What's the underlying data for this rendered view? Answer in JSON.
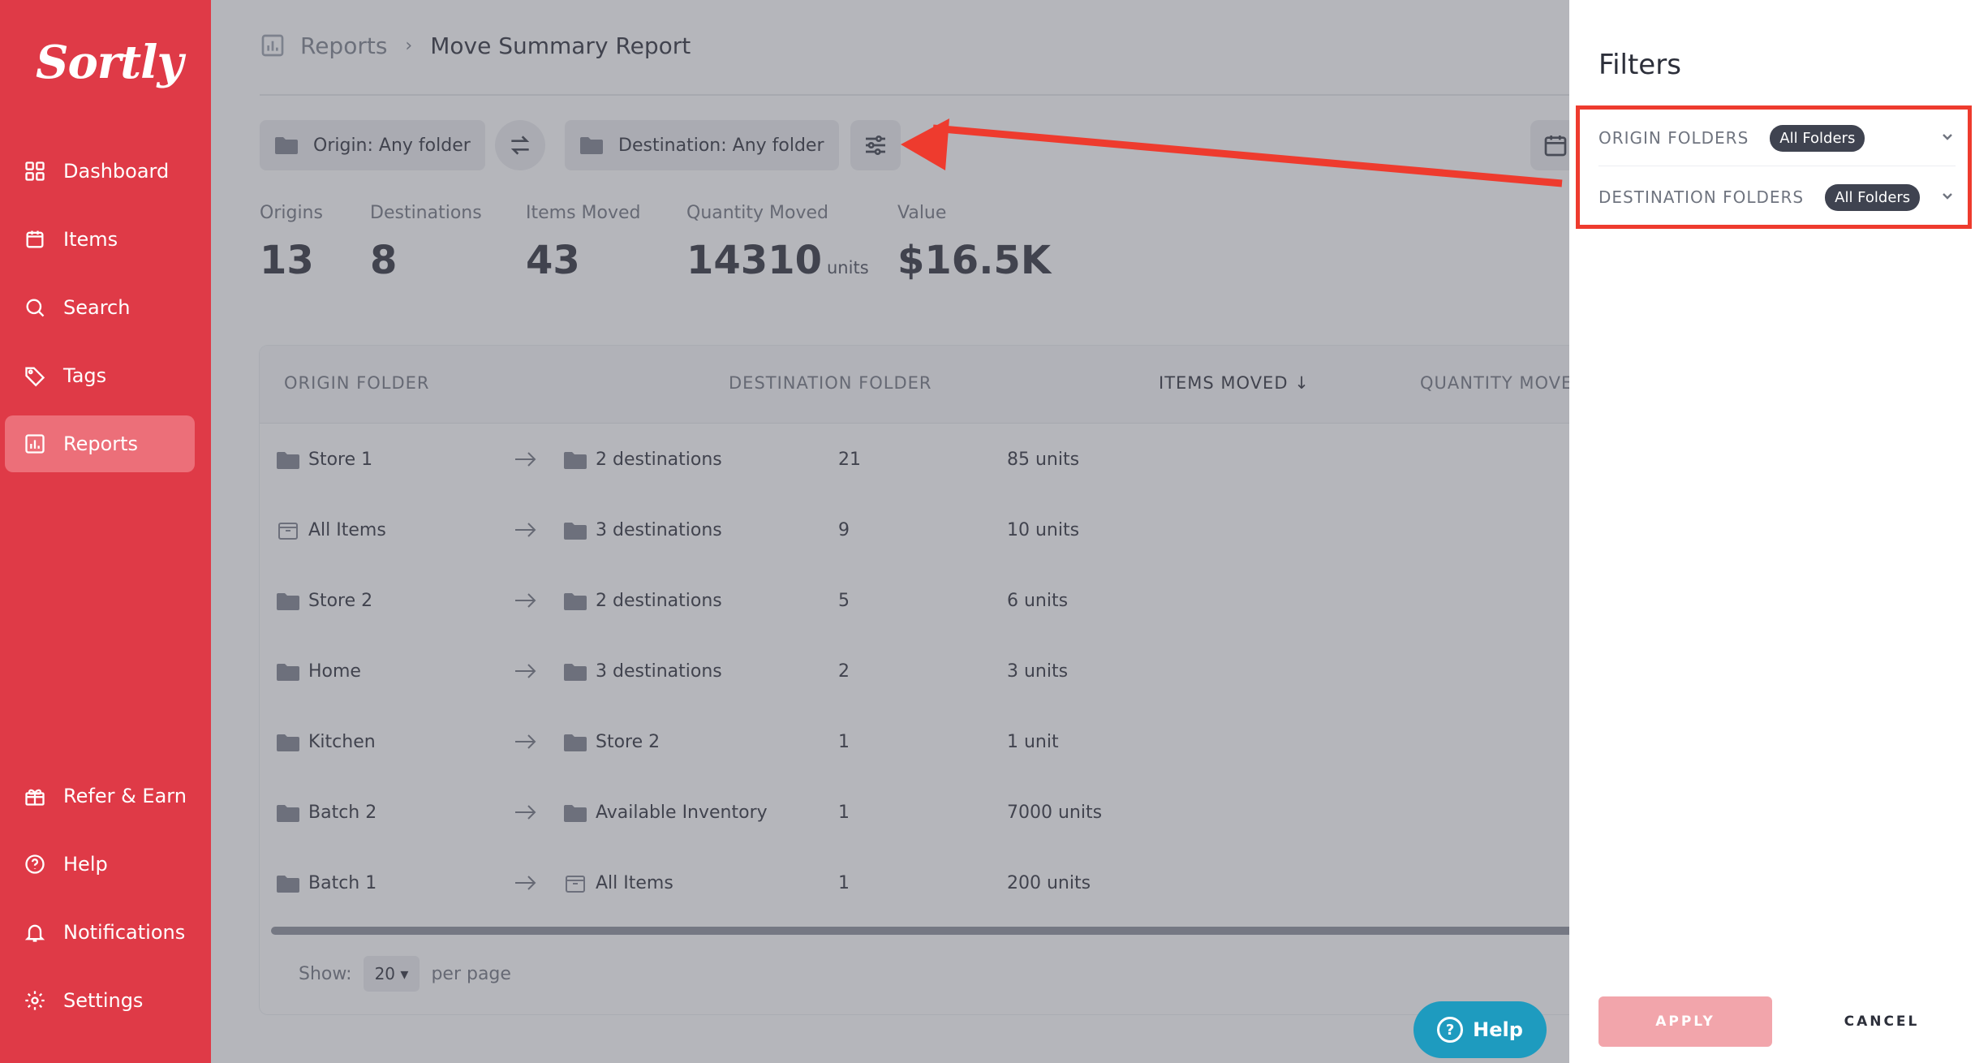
{
  "brand": {
    "logo_text": "Sortly",
    "accent": "#df3a47"
  },
  "sidebar": {
    "items": [
      {
        "label": "Dashboard",
        "icon": "dashboard-icon"
      },
      {
        "label": "Items",
        "icon": "items-icon"
      },
      {
        "label": "Search",
        "icon": "search-icon"
      },
      {
        "label": "Tags",
        "icon": "tag-icon"
      },
      {
        "label": "Reports",
        "icon": "reports-icon",
        "active": true
      }
    ],
    "bottom_items": [
      {
        "label": "Refer & Earn",
        "icon": "gift-icon"
      },
      {
        "label": "Help",
        "icon": "help-icon"
      },
      {
        "label": "Notifications",
        "icon": "bell-icon"
      },
      {
        "label": "Settings",
        "icon": "gear-icon"
      }
    ]
  },
  "breadcrumb": {
    "root": "Reports",
    "current": "Move Summary Report"
  },
  "toolbar": {
    "origin_label": "Origin: Any folder",
    "destination_label": "Destination: Any folder"
  },
  "stats": [
    {
      "label": "Origins",
      "value": "13",
      "unit": ""
    },
    {
      "label": "Destinations",
      "value": "8",
      "unit": ""
    },
    {
      "label": "Items Moved",
      "value": "43",
      "unit": ""
    },
    {
      "label": "Quantity Moved",
      "value": "14310",
      "unit": "units"
    },
    {
      "label": "Value",
      "value": "$16.5K",
      "unit": ""
    }
  ],
  "table": {
    "columns": [
      "ORIGIN FOLDER",
      "DESTINATION FOLDER",
      "ITEMS MOVED",
      "QUANTITY MOVED"
    ],
    "sort_indicator": "↓",
    "rows": [
      {
        "origin": "Store 1",
        "origin_icon": "folder-icon",
        "destination": "2 destinations",
        "dest_icon": "folder-icon",
        "items": "21",
        "quantity": "85 units"
      },
      {
        "origin": "All Items",
        "origin_icon": "box-icon",
        "destination": "3 destinations",
        "dest_icon": "folder-icon",
        "items": "9",
        "quantity": "10 units"
      },
      {
        "origin": "Store 2",
        "origin_icon": "folder-icon",
        "destination": "2 destinations",
        "dest_icon": "folder-icon",
        "items": "5",
        "quantity": "6 units"
      },
      {
        "origin": "Home",
        "origin_icon": "folder-icon",
        "destination": "3 destinations",
        "dest_icon": "folder-icon",
        "items": "2",
        "quantity": "3 units"
      },
      {
        "origin": "Kitchen",
        "origin_icon": "folder-icon",
        "destination": "Store 2",
        "dest_icon": "folder-icon",
        "items": "1",
        "quantity": "1 unit"
      },
      {
        "origin": "Batch 2",
        "origin_icon": "folder-icon",
        "destination": "Available Inventory",
        "dest_icon": "folder-icon",
        "items": "1",
        "quantity": "7000 units"
      },
      {
        "origin": "Batch 1",
        "origin_icon": "folder-icon",
        "destination": "All Items",
        "dest_icon": "box-icon",
        "items": "1",
        "quantity": "200 units"
      }
    ]
  },
  "pagination": {
    "show_label": "Show:",
    "page_size": "20",
    "per_page_label": "per page"
  },
  "help_button": {
    "label": "Help"
  },
  "filters": {
    "title": "Filters",
    "origin": {
      "label": "ORIGIN FOLDERS",
      "value": "All Folders"
    },
    "destination": {
      "label": "DESTINATION FOLDERS",
      "value": "All Folders"
    },
    "apply_label": "APPLY",
    "cancel_label": "CANCEL"
  }
}
